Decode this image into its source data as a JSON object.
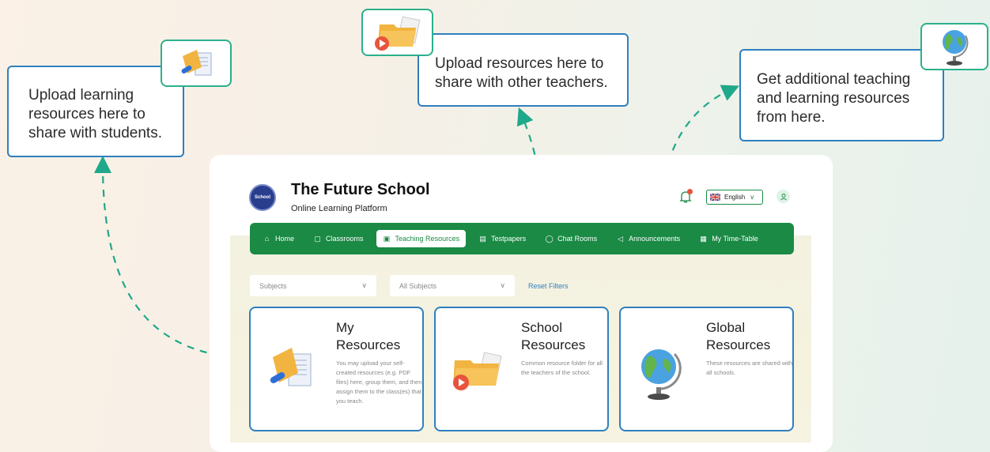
{
  "callouts": {
    "learning": "Upload learning resources here to share with students.",
    "teachers": "Upload resources here to share with other teachers.",
    "additional": "Get additional teaching and learning resources from here."
  },
  "header": {
    "logo_text": "School",
    "title": "The Future School",
    "subtitle": "Online Learning Platform",
    "language": "English",
    "notification_count": "0"
  },
  "nav": {
    "items": [
      {
        "label": "Home",
        "icon": "home-icon"
      },
      {
        "label": "Classrooms",
        "icon": "book-icon"
      },
      {
        "label": "Teaching Resources",
        "icon": "resources-icon",
        "active": true
      },
      {
        "label": "Testpapers",
        "icon": "testpaper-icon"
      },
      {
        "label": "Chat Rooms",
        "icon": "chat-icon"
      },
      {
        "label": "Announcements",
        "icon": "megaphone-icon"
      },
      {
        "label": "My Time-Table",
        "icon": "calendar-icon"
      }
    ]
  },
  "filters": {
    "subjects": "Subjects",
    "all_subjects": "All Subjects",
    "reset": "Reset Filters"
  },
  "cards": [
    {
      "title1": "My",
      "title2": "Resources",
      "desc": "You may upload your self-created resources (e.g. PDF files) here, group them, and then assign them to the class(es) that you teach."
    },
    {
      "title1": "School",
      "title2": "Resources",
      "desc": "Common resource folder for all the teachers of the school."
    },
    {
      "title1": "Global",
      "title2": "Resources",
      "desc": "These resources are shared with all schools."
    }
  ],
  "colors": {
    "nav_green": "#1a8a45",
    "card_border": "#2f7fbf",
    "arrow_teal": "#20a88a"
  }
}
